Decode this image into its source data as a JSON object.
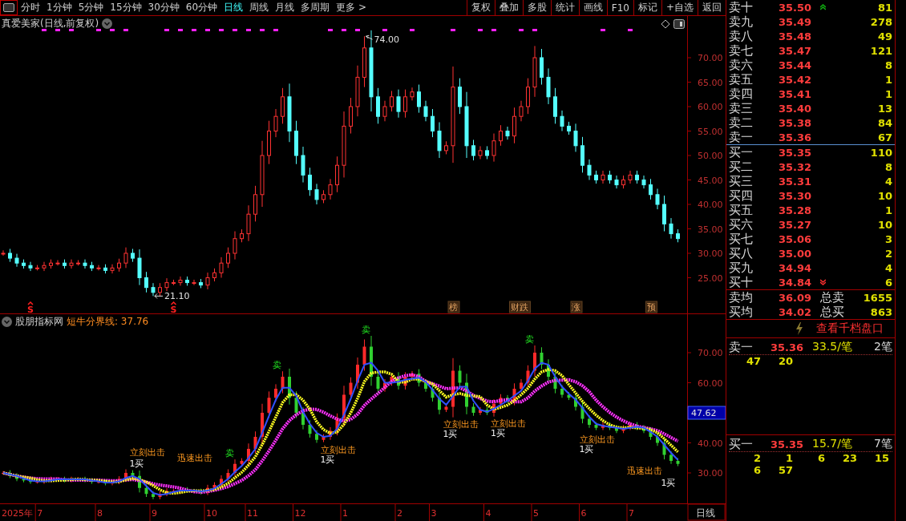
{
  "toolbar": {
    "periods": [
      {
        "label": "分时",
        "selected": false
      },
      {
        "label": "1分钟",
        "selected": false
      },
      {
        "label": "5分钟",
        "selected": false
      },
      {
        "label": "15分钟",
        "selected": false
      },
      {
        "label": "30分钟",
        "selected": false
      },
      {
        "label": "60分钟",
        "selected": false
      },
      {
        "label": "日线",
        "selected": true
      },
      {
        "label": "周线",
        "selected": false
      },
      {
        "label": "月线",
        "selected": false
      },
      {
        "label": "多周期",
        "selected": false
      },
      {
        "label": "更多 >",
        "selected": false
      }
    ],
    "buttons": [
      "复权",
      "叠加",
      "多股",
      "统计",
      "画线",
      "F10",
      "标记",
      "+自选",
      "返回"
    ]
  },
  "chart": {
    "title": "真爱美家(日线,前复权)",
    "high_label": "74.00",
    "low_label": "21.10",
    "s_markers": [
      "S",
      "S"
    ],
    "event_tags": [
      "榜",
      "财跌",
      "涨",
      "预"
    ],
    "price_ticks": [
      "70.00",
      "65.00",
      "60.00",
      "55.00",
      "50.00",
      "45.00",
      "40.00",
      "35.00",
      "30.00",
      "25.00"
    ]
  },
  "indicator": {
    "title": "股朋指标网",
    "line_label": "短牛分界线: 37.76",
    "current_value": "47.62",
    "price_ticks": [
      "70.00",
      "60.00",
      "40.00",
      "30.00"
    ],
    "signals": [
      {
        "kind": "sell",
        "text": "卖"
      },
      {
        "kind": "sell",
        "text": "卖"
      },
      {
        "kind": "sell",
        "text": "卖"
      },
      {
        "kind": "sell",
        "text": "卖"
      },
      {
        "kind": "strike",
        "text": "立刻出击"
      },
      {
        "kind": "buy",
        "text": "1买"
      },
      {
        "kind": "strike",
        "text": "迅速出击"
      },
      {
        "kind": "strike",
        "text": "立刻出击"
      },
      {
        "kind": "buy",
        "text": "1买"
      },
      {
        "kind": "strike",
        "text": "立刻出击"
      },
      {
        "kind": "buy",
        "text": "1买"
      },
      {
        "kind": "strike",
        "text": "立刻出击"
      },
      {
        "kind": "buy",
        "text": "1买"
      },
      {
        "kind": "strike",
        "text": "立刻出击"
      },
      {
        "kind": "buy",
        "text": "1买"
      },
      {
        "kind": "strike",
        "text": "迅速出击"
      },
      {
        "kind": "buy",
        "text": "1买"
      }
    ]
  },
  "time_axis": {
    "labels": [
      "2025年",
      "7",
      "8",
      "9",
      "10",
      "11",
      "12",
      "1",
      "2",
      "3",
      "4",
      "5",
      "6",
      "7"
    ],
    "period": "日线"
  },
  "order_book": {
    "asks": [
      {
        "label": "卖十",
        "price": "35.50",
        "volume": "81",
        "arrow": true
      },
      {
        "label": "卖九",
        "price": "35.49",
        "volume": "278",
        "arrow": false
      },
      {
        "label": "卖八",
        "price": "35.48",
        "volume": "49",
        "arrow": false
      },
      {
        "label": "卖七",
        "price": "35.47",
        "volume": "121",
        "arrow": false
      },
      {
        "label": "卖六",
        "price": "35.44",
        "volume": "8",
        "arrow": false
      },
      {
        "label": "卖五",
        "price": "35.42",
        "volume": "1",
        "arrow": false
      },
      {
        "label": "卖四",
        "price": "35.41",
        "volume": "1",
        "arrow": false
      },
      {
        "label": "卖三",
        "price": "35.40",
        "volume": "13",
        "arrow": false
      },
      {
        "label": "卖二",
        "price": "35.38",
        "volume": "84",
        "arrow": false
      },
      {
        "label": "卖一",
        "price": "35.36",
        "volume": "67",
        "arrow": false
      }
    ],
    "bids": [
      {
        "label": "买一",
        "price": "35.35",
        "volume": "110",
        "arrow": false
      },
      {
        "label": "买二",
        "price": "35.32",
        "volume": "8",
        "arrow": false
      },
      {
        "label": "买三",
        "price": "35.31",
        "volume": "4",
        "arrow": false
      },
      {
        "label": "买四",
        "price": "35.30",
        "volume": "10",
        "arrow": false
      },
      {
        "label": "买五",
        "price": "35.28",
        "volume": "1",
        "arrow": false
      },
      {
        "label": "买六",
        "price": "35.27",
        "volume": "10",
        "arrow": false
      },
      {
        "label": "买七",
        "price": "35.06",
        "volume": "3",
        "arrow": false
      },
      {
        "label": "买八",
        "price": "35.00",
        "volume": "2",
        "arrow": false
      },
      {
        "label": "买九",
        "price": "34.94",
        "volume": "4",
        "arrow": false
      },
      {
        "label": "买十",
        "price": "34.84",
        "volume": "6",
        "arrow": true
      }
    ],
    "summary": [
      {
        "label": "卖均",
        "price": "36.09",
        "total_label": "总卖",
        "total": "1655"
      },
      {
        "label": "买均",
        "price": "34.02",
        "total_label": "总买",
        "total": "863"
      }
    ],
    "depth_link": "查看千档盘口",
    "queues": [
      {
        "label": "卖一",
        "price": "35.36",
        "avg": "33.5/笔",
        "count": "2笔",
        "orders": [
          "47",
          "20"
        ]
      },
      {
        "label": "买一",
        "price": "35.35",
        "avg": "15.7/笔",
        "count": "7笔",
        "orders": [
          "2",
          "1",
          "6",
          "23",
          "15",
          "6",
          "57"
        ]
      }
    ]
  }
}
